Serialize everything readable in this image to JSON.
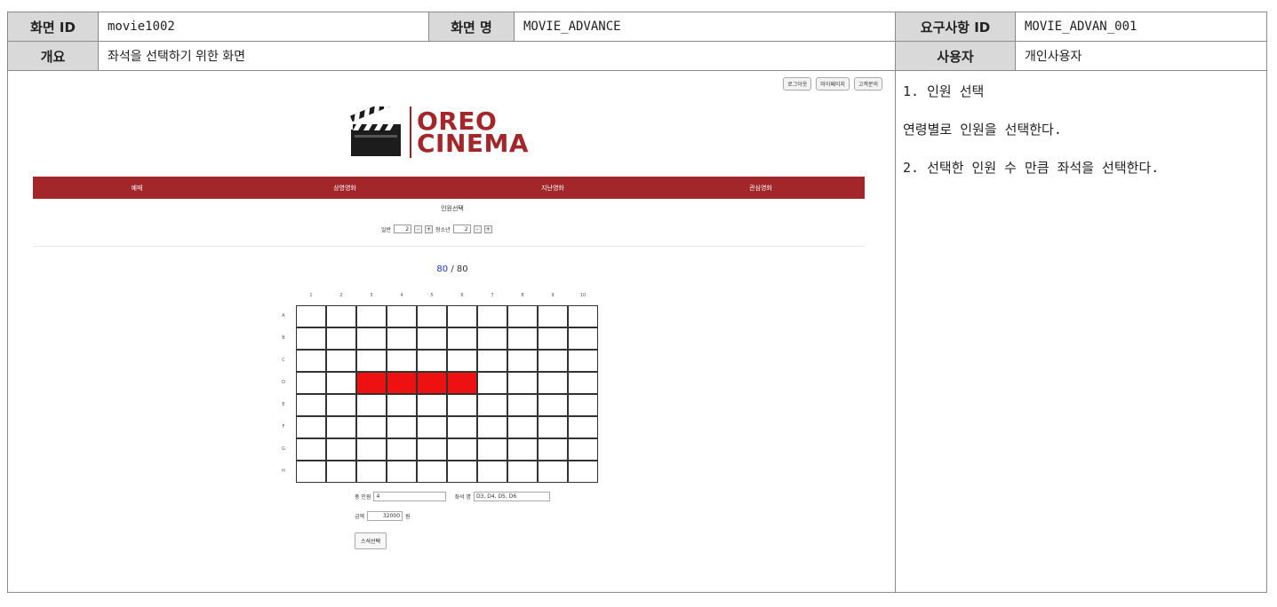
{
  "header": {
    "screen_id_label": "화면 ID",
    "screen_id": "movie1002",
    "screen_name_label": "화면 명",
    "screen_name": "MOVIE_ADVANCE",
    "req_id_label": "요구사항 ID",
    "req_id": "MOVIE_ADVAN_001",
    "summary_label": "개요",
    "summary": "좌석을 선택하기 위한 화면",
    "user_label": "사용자",
    "user": "개인사용자"
  },
  "notes": [
    "1. 인원 선택",
    "연령별로 인원을 선택한다.",
    "2. 선택한 인원 수 만큼 좌석을 선택한다."
  ],
  "mock": {
    "top_links": [
      "로그아웃",
      "마이페이지",
      "고객문의"
    ],
    "logo": {
      "line1": "OREO",
      "line2": "CINEMA",
      "icon": "clapperboard-icon"
    },
    "nav": [
      "예매",
      "상영영화",
      "지난영화",
      "관심영화"
    ],
    "section_title": "인원선택",
    "people": {
      "adult_label": "일반",
      "adult_count": "2",
      "youth_label": "청소년",
      "youth_count": "2",
      "minus": "-",
      "plus": "+"
    },
    "seat_count": {
      "selected": "80",
      "separator": "/",
      "total": "80"
    },
    "columns": [
      "1",
      "2",
      "3",
      "4",
      "5",
      "6",
      "7",
      "8",
      "9",
      "10"
    ],
    "rows": [
      "A",
      "B",
      "C",
      "D",
      "E",
      "F",
      "G",
      "H"
    ],
    "selected_seats": [
      "D3",
      "D4",
      "D5",
      "D6"
    ],
    "selected_color": "#ee1111",
    "form": {
      "total_people_label": "총 인원",
      "total_people": "4",
      "seat_no_label": "좌석 명",
      "seat_no": "D3, D4, D5, D6",
      "price_label": "금액",
      "price": "32000",
      "price_unit": "원",
      "reselect_button": "스석선택"
    },
    "brand_color": "#a3262a"
  }
}
